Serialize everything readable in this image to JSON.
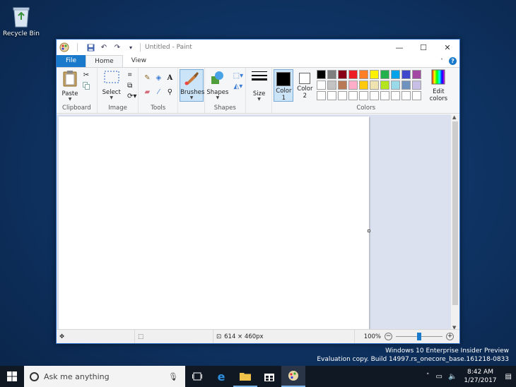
{
  "desktop": {
    "recycle_bin_label": "Recycle Bin",
    "watermark_line1": "Windows 10 Enterprise Insider Preview",
    "watermark_line2": "Evaluation copy. Build 14997.rs_onecore_base.161218-0833"
  },
  "window": {
    "title": "Untitled - Paint",
    "controls": {
      "minimize": "—",
      "maximize": "☐",
      "close": "✕"
    }
  },
  "tabs": {
    "file": "File",
    "home": "Home",
    "view": "View"
  },
  "ribbon": {
    "clipboard": {
      "label": "Clipboard",
      "paste": "Paste"
    },
    "image": {
      "label": "Image",
      "select": "Select"
    },
    "tools": {
      "label": "Tools"
    },
    "brushes": {
      "label": "Brushes"
    },
    "shapes": {
      "label": "Shapes",
      "button": "Shapes"
    },
    "size": {
      "label": "Size"
    },
    "colors": {
      "label": "Colors",
      "color1": "Color",
      "color1_num": "1",
      "color2": "Color",
      "color2_num": "2",
      "edit_colors": "Edit",
      "edit_colors2": "colors",
      "palette_row1": [
        "#000000",
        "#7f7f7f",
        "#880015",
        "#ed1c24",
        "#ff7f27",
        "#fff200",
        "#22b14c",
        "#00a2e8",
        "#3f48cc",
        "#a349a4"
      ],
      "palette_row2": [
        "#ffffff",
        "#c3c3c3",
        "#b97a57",
        "#ffaec9",
        "#ffc90e",
        "#efe4b0",
        "#b5e61d",
        "#99d9ea",
        "#7092be",
        "#c8bfe7"
      ],
      "palette_row3": [
        "#ffffff",
        "#ffffff",
        "#ffffff",
        "#ffffff",
        "#ffffff",
        "#ffffff",
        "#ffffff",
        "#ffffff",
        "#ffffff",
        "#ffffff"
      ],
      "primary": "#000000",
      "secondary": "#ffffff"
    }
  },
  "status": {
    "canvas_size": "614 × 460px",
    "zoom": "100%"
  },
  "taskbar": {
    "search_placeholder": "Ask me anything",
    "time": "8:42 AM",
    "date": "1/27/2017"
  }
}
